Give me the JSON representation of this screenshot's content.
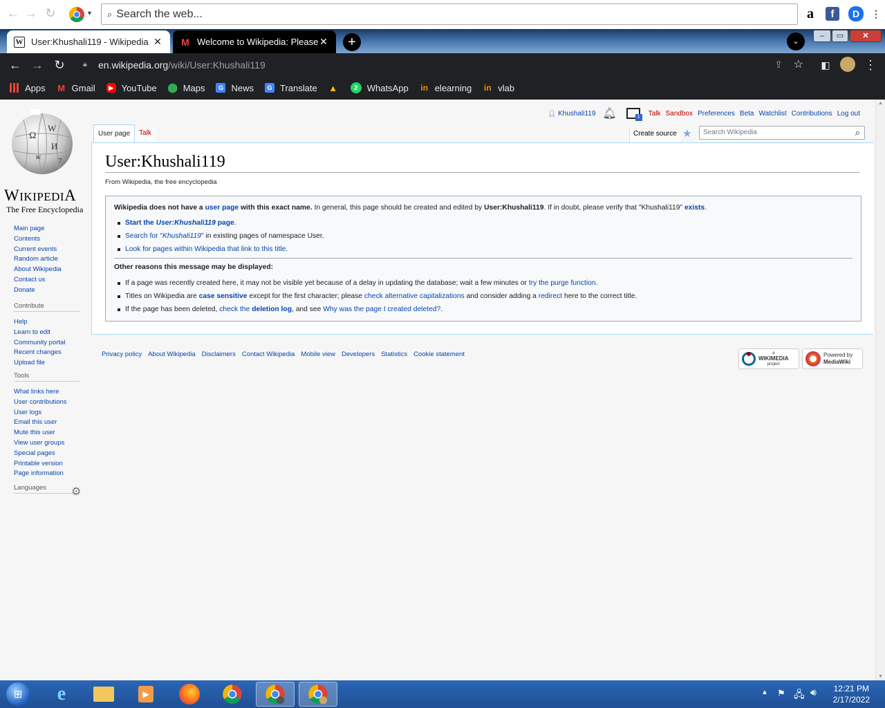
{
  "browser": {
    "search_placeholder": "Search the web...",
    "tabs": [
      {
        "title": "User:Khushali119 - Wikipedia",
        "active": true
      },
      {
        "title": "Welcome to Wikipedia: Please co",
        "active": false
      }
    ],
    "url_host": "en.wikipedia.org",
    "url_path": "/wiki/User:Khushali119",
    "bookmarks": [
      "Apps",
      "Gmail",
      "YouTube",
      "Maps",
      "News",
      "Translate",
      "",
      "WhatsApp",
      "elearning",
      "vlab"
    ]
  },
  "wiki": {
    "logo_word": "Wikipedia",
    "logo_tagline": "The Free Encyclopedia",
    "personal": {
      "user": "Khushali119",
      "talk": "Talk",
      "sandbox": "Sandbox",
      "preferences": "Preferences",
      "beta": "Beta",
      "watchlist": "Watchlist",
      "contributions": "Contributions",
      "logout": "Log out"
    },
    "nav": [
      "Main page",
      "Contents",
      "Current events",
      "Random article",
      "About Wikipedia",
      "Contact us",
      "Donate"
    ],
    "contribute": {
      "heading": "Contribute",
      "items": [
        "Help",
        "Learn to edit",
        "Community portal",
        "Recent changes",
        "Upload file"
      ]
    },
    "tools": {
      "heading": "Tools",
      "items": [
        "What links here",
        "User contributions",
        "User logs",
        "Email this user",
        "Mute this user",
        "View user groups",
        "Special pages",
        "Printable version",
        "Page information"
      ]
    },
    "languages": "Languages",
    "tabs": {
      "user_page": "User page",
      "talk": "Talk",
      "create_source": "Create source"
    },
    "search_placeholder": "Search Wikipedia",
    "title": "User:Khushali119",
    "subtitle": "From Wikipedia, the free encyclopedia",
    "notice": {
      "p1_b1": "Wikipedia does not have a ",
      "p1_link": "user page",
      "p1_b2": " with this exact name.",
      "p1_t1": " In general, this page should be created and edited by ",
      "p1_user": "User:Khushali119",
      "p1_t2": ". If in doubt, please verify that \"Khushali119\" ",
      "p1_exists": "exists",
      "p1_end": ".",
      "li1_a": "Start the ",
      "li1_i": "User:Khushali119",
      "li1_b": " page",
      "li1_end": ".",
      "li2_a": "Search for \"",
      "li2_i": "Khushali119",
      "li2_b": "\"",
      "li2_t": " in existing pages of namespace User.",
      "li3": "Look for pages within Wikipedia that link to this title.",
      "other_heading": "Other reasons this message may be displayed:",
      "r1_t": "If a page was recently created here, it may not be visible yet because of a delay in updating the database; wait a few minutes or ",
      "r1_link": "try the purge function",
      "r1_end": ".",
      "r2_t1": "Titles on Wikipedia are ",
      "r2_link1": "case sensitive",
      "r2_t2": " except for the first character; please ",
      "r2_link2": "check alternative capitalizations",
      "r2_t3": " and consider adding a ",
      "r2_link3": "redirect",
      "r2_t4": " here to the correct title.",
      "r3_t1": "If the page has been deleted, ",
      "r3_link1a": "check the ",
      "r3_link1b": "deletion log",
      "r3_t2": ", and see ",
      "r3_link2": "Why was the page I created deleted?",
      "r3_end": "."
    },
    "footer": [
      "Privacy policy",
      "About Wikipedia",
      "Disclaimers",
      "Contact Wikipedia",
      "Mobile view",
      "Developers",
      "Statistics",
      "Cookie statement"
    ],
    "badge_wikimedia": "WIKIMEDIA",
    "badge_wikimedia_small": "project",
    "badge_wikimedia_top": "a",
    "badge_mw_line1": "Powered by",
    "badge_mw_line2": "MediaWiki"
  },
  "taskbar": {
    "time": "12:21 PM",
    "date": "2/17/2022"
  }
}
